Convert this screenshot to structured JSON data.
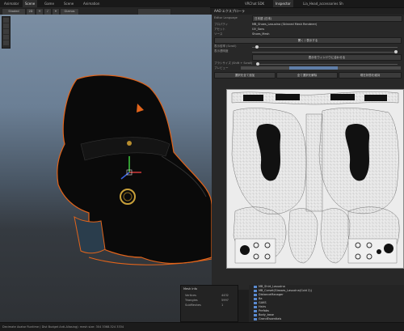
{
  "tabs": [
    "Animator",
    "Scene",
    "Game",
    "Scene",
    "Animation",
    "VRChat SDK",
    "Inspector",
    "Lia_Head_accessories Sh"
  ],
  "toolbar": {
    "shading_mode": "Shaded",
    "view_2d": "2D",
    "gizmos": "Gizmos"
  },
  "panel": {
    "title": "AAO エクスプローラ",
    "language_label": "Editor Language",
    "language_value": "日本語 (日本)",
    "rows": [
      {
        "label": "プロパティ",
        "value": "MB_Shoes_Lasuolna (Skinned Mesh Renderer)"
      },
      {
        "label": "アセット",
        "value": "UV_Sans"
      },
      {
        "label": "ソース",
        "value": "Shoes_Mesh"
      }
    ],
    "open_button": "開く / 表示する",
    "scale_label": "表示倍率 (Scroll)",
    "opacity_label": "表示透明度",
    "window_button": "表示をウィンドウに合わせる",
    "brush_label": "ブラシサイズ (Shift + Scroll)",
    "preview_label": "プレビュー",
    "action_buttons": [
      "選択を全て追加",
      "全て選択を解除",
      "現在状態を維持"
    ]
  },
  "mesh_info": {
    "title": "Mesh Info",
    "rows": [
      {
        "label": "Vertices",
        "value": "4432"
      },
      {
        "label": "Triangles",
        "value": "5997"
      },
      {
        "label": "SubMeshes",
        "value": "1"
      }
    ]
  },
  "hierarchy": {
    "items": [
      "MB_Shirt_Lasuolna",
      "MB_Corset(Glasses_Lasuolna(Cold 2))",
      "DistanceManager",
      "Ba",
      "GAKS",
      "Hairs",
      "Prefabs",
      "Body_base",
      "GrandEssentials"
    ]
  },
  "status_bar": "Decimate Avatar Runtime ( Dist Budget Anti-Aliasing): mesh size: 304 3368.324 3334"
}
